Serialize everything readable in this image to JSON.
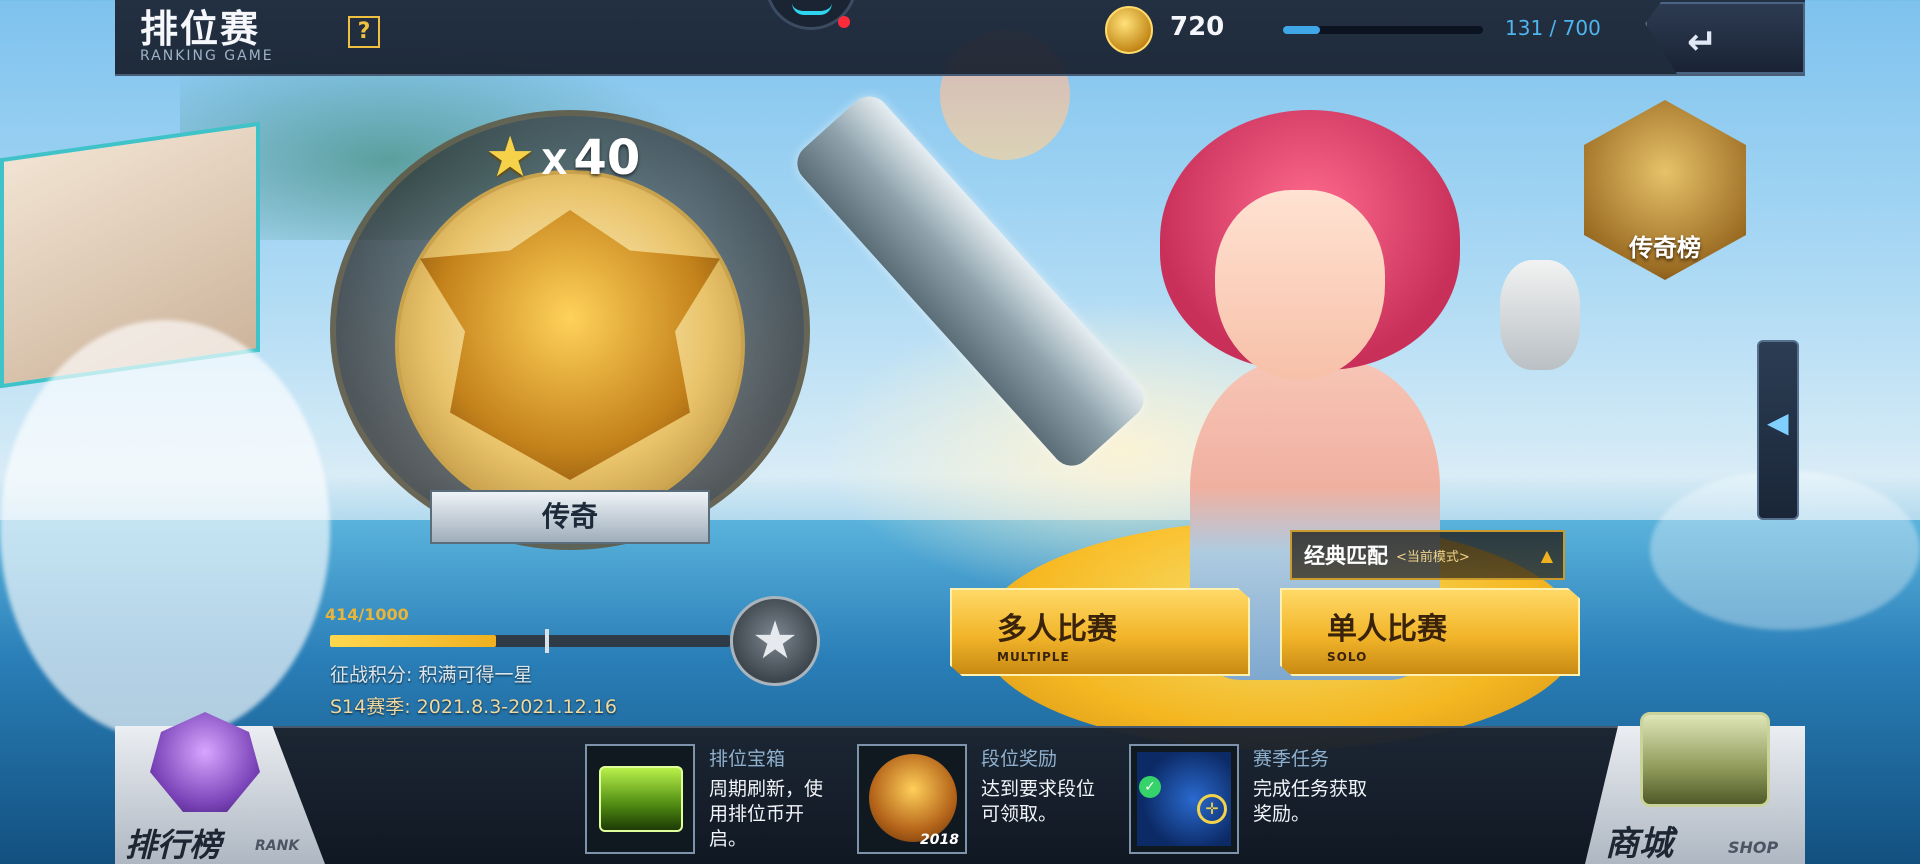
{
  "header": {
    "title": "排位赛",
    "subtitle": "RANKING GAME",
    "help_icon": "?",
    "currency_value": "720",
    "experience": {
      "current": 131,
      "max": 700,
      "text": "131 / 700"
    },
    "back_icon": "↵"
  },
  "rank": {
    "star_icon": "★",
    "star_prefix": "X",
    "star_count": "40",
    "tier_name": "传奇"
  },
  "progress": {
    "text": "414/1000",
    "current": 414,
    "max": 1000,
    "next_star_icon": "★",
    "points_note": "征战积分: 积满可得一星",
    "season": "S14赛季: 2021.8.3-2021.12.16"
  },
  "legend_board": {
    "label": "传奇榜"
  },
  "side_toggle": {
    "icon": "◀"
  },
  "mode": {
    "title": "经典匹配",
    "current_tag": "<当前模式>",
    "arrow_icon": "▲"
  },
  "buttons": {
    "multiple": {
      "label": "多人比赛",
      "sub": "MULTIPLE"
    },
    "solo": {
      "label": "单人比赛",
      "sub": "SOLO"
    }
  },
  "bottom": {
    "rank_board": {
      "label": "排行榜",
      "sub": "RANK"
    },
    "rewards": [
      {
        "title": "排位宝箱",
        "desc": "周期刷新，使用排位币开启。"
      },
      {
        "title": "段位奖励",
        "desc": "达到要求段位可领取。",
        "year": "2018"
      },
      {
        "title": "赛季任务",
        "desc": "完成任务获取奖励。"
      }
    ],
    "shop": {
      "label": "商城",
      "sub": "SHOP"
    }
  },
  "colors": {
    "accent_gold": "#f2b52a",
    "exp_blue": "#3fa6e8",
    "progress_gold": "#ffd84f"
  }
}
